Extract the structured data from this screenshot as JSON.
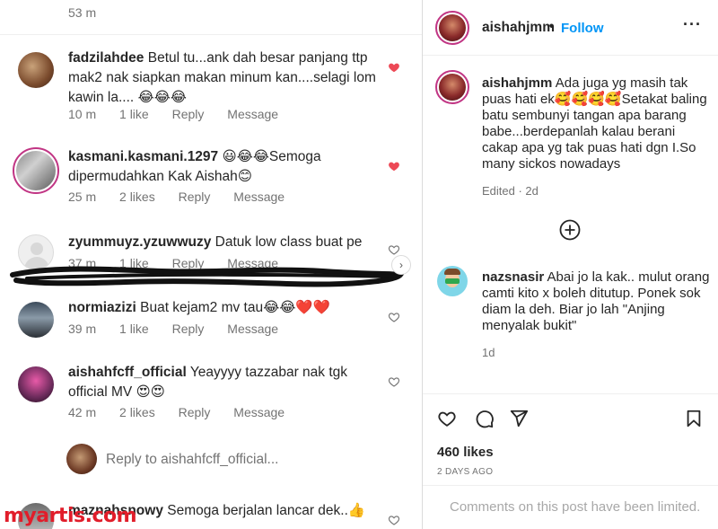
{
  "left": {
    "top_meta": "53 m",
    "comments": [
      {
        "username": "fadzilahdee",
        "text": "Betul tu...ank dah besar panjang ttp mak2 nak siapkan makan minum kan....selagi lom kawin la.... 😂😂😂",
        "time": "10 m",
        "likes": "1 like",
        "reply": "Reply",
        "message": "Message",
        "liked": true
      },
      {
        "username": "kasmani.kasmani.1297",
        "text": "😃😂😂Semoga dipermudahkan Kak Aishah😊",
        "time": "25 m",
        "likes": "2 likes",
        "reply": "Reply",
        "message": "Message",
        "liked": true
      },
      {
        "username": "zyummuyz.yzuwwuzy",
        "text": "Datuk low class buat pe",
        "time": "37 m",
        "likes": "1 like",
        "reply": "Reply",
        "message": "Message",
        "liked": false
      },
      {
        "username": "normiazizi",
        "text": "Buat kejam2 mv tau😂😂❤️❤️",
        "time": "39 m",
        "likes": "1 like",
        "reply": "Reply",
        "message": "Message",
        "liked": false
      },
      {
        "username": "aishahfcff_official",
        "text": "Yeayyyy tazzabar nak tgk official MV 😍😍",
        "time": "42 m",
        "likes": "2 likes",
        "reply": "Reply",
        "message": "Message",
        "liked": false
      },
      {
        "username": "maznahsnowy",
        "text": "Semoga berjalan lancar dek..👍",
        "liked": false
      }
    ],
    "reply_placeholder": "Reply to aishahfcff_official...",
    "watermark": "myartis.com"
  },
  "right": {
    "header": {
      "username": "aishahjmm",
      "dot": "•",
      "follow": "Follow",
      "more": "···"
    },
    "caption": {
      "username": "aishahjmm",
      "text": "Ada juga yg masih tak puas hati ek🥰🥰🥰🥰Setakat baling batu sembunyi tangan apa barang babe...berdepanlah kalau berani cakap apa yg tak puas hati dgn I.So many sickos nowadays",
      "edited": "Edited · 2d"
    },
    "comment": {
      "username": "nazsnasir",
      "text": "Abai jo la kak.. mulut orang camti kito x boleh ditutup. Ponek sok diam la deh. Biar jo lah \"Anjing menyalak bukit\"",
      "time": "1d"
    },
    "likes": "460 likes",
    "date": "2 DAYS AGO",
    "limited": "Comments on this post have been limited."
  },
  "colors": {
    "link_blue": "#0095f6",
    "heart_red": "#ed4956",
    "meta_gray": "#737373",
    "watermark_red": "#e11d2a"
  }
}
